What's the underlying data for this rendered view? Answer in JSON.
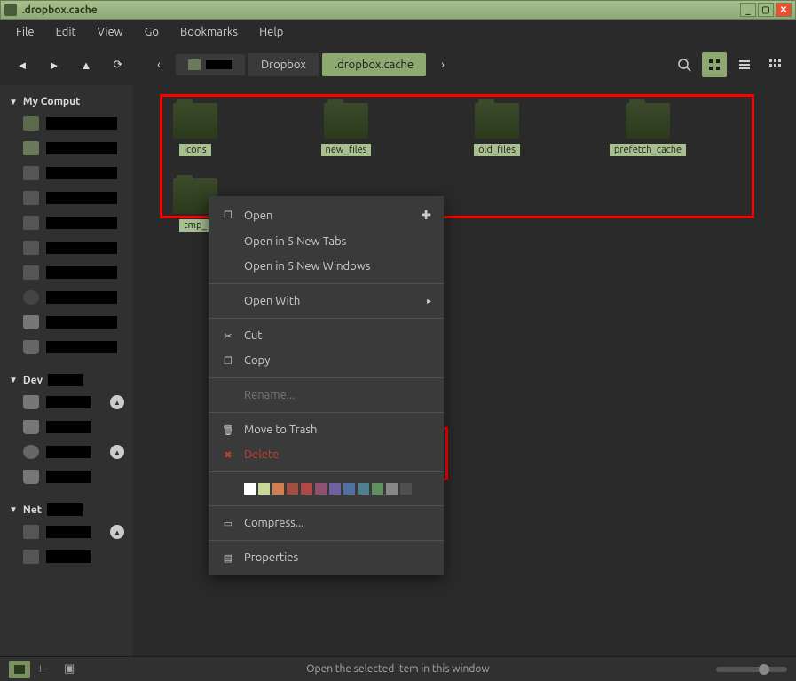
{
  "window_title": ".dropbox.cache",
  "menubar": [
    "File",
    "Edit",
    "View",
    "Go",
    "Bookmarks",
    "Help"
  ],
  "breadcrumbs": {
    "back_chevron": "‹",
    "home": "",
    "redacted": "",
    "parent": "Dropbox",
    "current": ".dropbox.cache",
    "fwd_chevron": "›"
  },
  "sidebar": {
    "computer_label": "My Comput",
    "devices_label": "Dev",
    "network_label": "Net"
  },
  "folders": [
    {
      "label": "icons"
    },
    {
      "label": "new_files"
    },
    {
      "label": "old_files"
    },
    {
      "label": "prefetch_cache"
    },
    {
      "label": "tmp_"
    }
  ],
  "context_menu": {
    "open": "Open",
    "open_tabs": "Open in 5 New Tabs",
    "open_windows": "Open in 5 New Windows",
    "open_with": "Open With",
    "cut": "Cut",
    "copy": "Copy",
    "rename": "Rename...",
    "move_trash": "Move to Trash",
    "delete": "Delete",
    "compress": "Compress...",
    "properties": "Properties",
    "colors": [
      "#ffffff",
      "#c8d89a",
      "#d08050",
      "#a05040",
      "#b04848",
      "#905070",
      "#7060a0",
      "#5070a0",
      "#508090",
      "#609060",
      "#888888",
      "#505050"
    ]
  },
  "statusbar": {
    "text": "Open the selected item in this window"
  }
}
